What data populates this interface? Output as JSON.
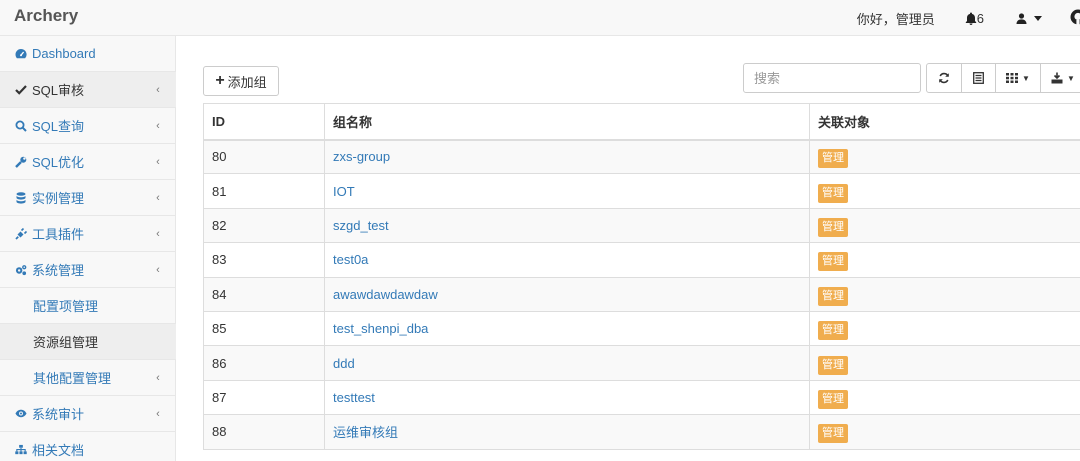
{
  "brand": "Archery",
  "nav": {
    "greeting": "你好，管理员",
    "notification_count": "6",
    "icons": [
      "bell-icon",
      "user-icon",
      "github-icon"
    ]
  },
  "sidebar": {
    "items": [
      {
        "label": "Dashboard",
        "icon": "dashboard-icon",
        "has_arrow": false
      },
      {
        "label": "SQL审核",
        "icon": "check-icon",
        "has_arrow": true,
        "active": true
      },
      {
        "label": "SQL查询",
        "icon": "search-icon",
        "has_arrow": true
      },
      {
        "label": "SQL优化",
        "icon": "wrench-icon",
        "has_arrow": true
      },
      {
        "label": "实例管理",
        "icon": "database-icon",
        "has_arrow": true
      },
      {
        "label": "工具插件",
        "icon": "plug-icon",
        "has_arrow": true
      },
      {
        "label": "系统管理",
        "icon": "gears-icon",
        "has_arrow": true
      },
      {
        "label": "配置项管理",
        "sub": true
      },
      {
        "label": "资源组管理",
        "sub": true,
        "active": true
      },
      {
        "label": "其他配置管理",
        "sub": true,
        "has_arrow": true
      },
      {
        "label": "系统审计",
        "icon": "eye-icon",
        "has_arrow": true
      },
      {
        "label": "相关文档",
        "icon": "sitemap-icon",
        "has_arrow": false
      }
    ]
  },
  "toolbar": {
    "add_label": "添加组",
    "search_placeholder": "搜索",
    "buttons": [
      "refresh-icon",
      "toggle-view-icon",
      "columns-icon",
      "export-icon"
    ]
  },
  "table": {
    "headers": {
      "id": "ID",
      "name": "组名称",
      "relation": "关联对象"
    },
    "badge_label": "管理",
    "rows": [
      {
        "id": "80",
        "name": "zxs-group"
      },
      {
        "id": "81",
        "name": "IOT"
      },
      {
        "id": "82",
        "name": "szgd_test"
      },
      {
        "id": "83",
        "name": "test0a"
      },
      {
        "id": "84",
        "name": "awawdawdawdaw"
      },
      {
        "id": "85",
        "name": "test_shenpi_dba"
      },
      {
        "id": "86",
        "name": "ddd"
      },
      {
        "id": "87",
        "name": "testtest"
      },
      {
        "id": "88",
        "name": "运维审核组"
      }
    ]
  },
  "colors": {
    "badge": "#f0ad4e",
    "link": "#337ab7",
    "sidebar_bg": "#f8f8f8"
  }
}
